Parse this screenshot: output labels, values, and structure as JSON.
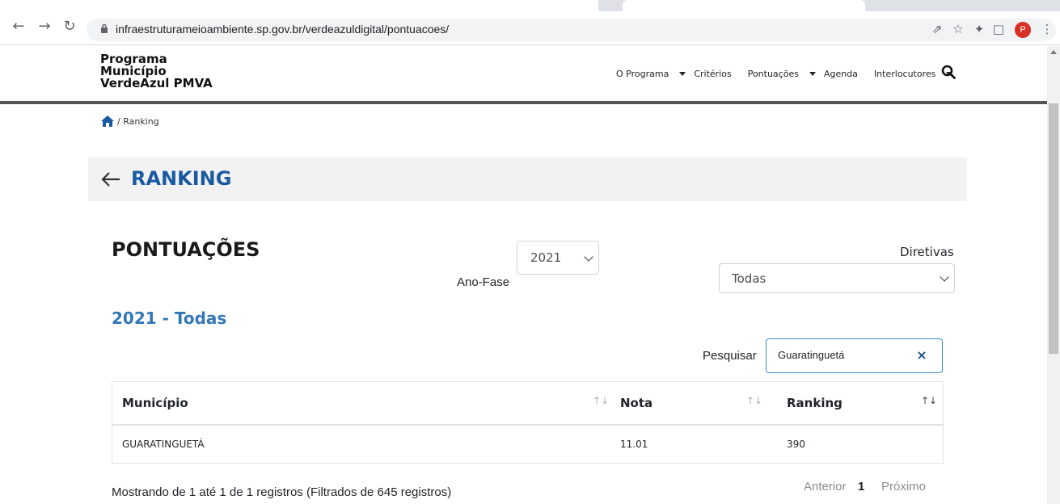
{
  "browser": {
    "url": "infraestruturameioambiente.sp.gov.br/verdeazuldigital/pontuacoes/",
    "avatar_letter": "P",
    "nav_icons": [
      "back-arrow-icon",
      "forward-arrow-icon",
      "reload-icon"
    ],
    "toolbar_icons": [
      "share-icon",
      "star-icon",
      "extensions-icon",
      "sidebar-icon",
      "menu-kebab-icon"
    ]
  },
  "site": {
    "logo_lines": [
      "Programa",
      "Município",
      "VerdeAzul PMVA"
    ],
    "nav": [
      {
        "label": "O Programa",
        "dropdown": true
      },
      {
        "label": "Critérios",
        "dropdown": false
      },
      {
        "label": "Pontuações",
        "dropdown": true
      },
      {
        "label": "Agenda",
        "dropdown": false
      },
      {
        "label": "Interlocutores",
        "dropdown": true
      }
    ]
  },
  "breadcrumb": {
    "separator": "/ Ranking"
  },
  "ranking_bar": {
    "title": "RANKING"
  },
  "pontuacoes": {
    "title": "PONTUAÇÕES",
    "ano_fase_label": "Ano-Fase",
    "ano_fase_value": "2021",
    "diretivas_label": "Diretivas",
    "diretivas_value": "Todas",
    "subtitle": "2021 - Todas"
  },
  "search": {
    "label": "Pesquisar",
    "value": "Guaratinguetá",
    "clear": "×"
  },
  "table": {
    "headers": [
      "Município",
      "Nota",
      "Ranking"
    ],
    "sort_glyph": "↑↓",
    "rows": [
      [
        "GUARATINGUETÁ",
        "11.01",
        "390"
      ]
    ]
  },
  "footer": {
    "info": "Mostrando de 1 até 1 de 1 registros (Filtrados de 645 registros)",
    "prev": "Anterior",
    "page": "1",
    "next": "Próximo"
  },
  "colors": {
    "ranking_title": "#1b5aa0",
    "subtitle": "#3478b6",
    "header_rule": "#555555",
    "avatar": "#d93025"
  }
}
